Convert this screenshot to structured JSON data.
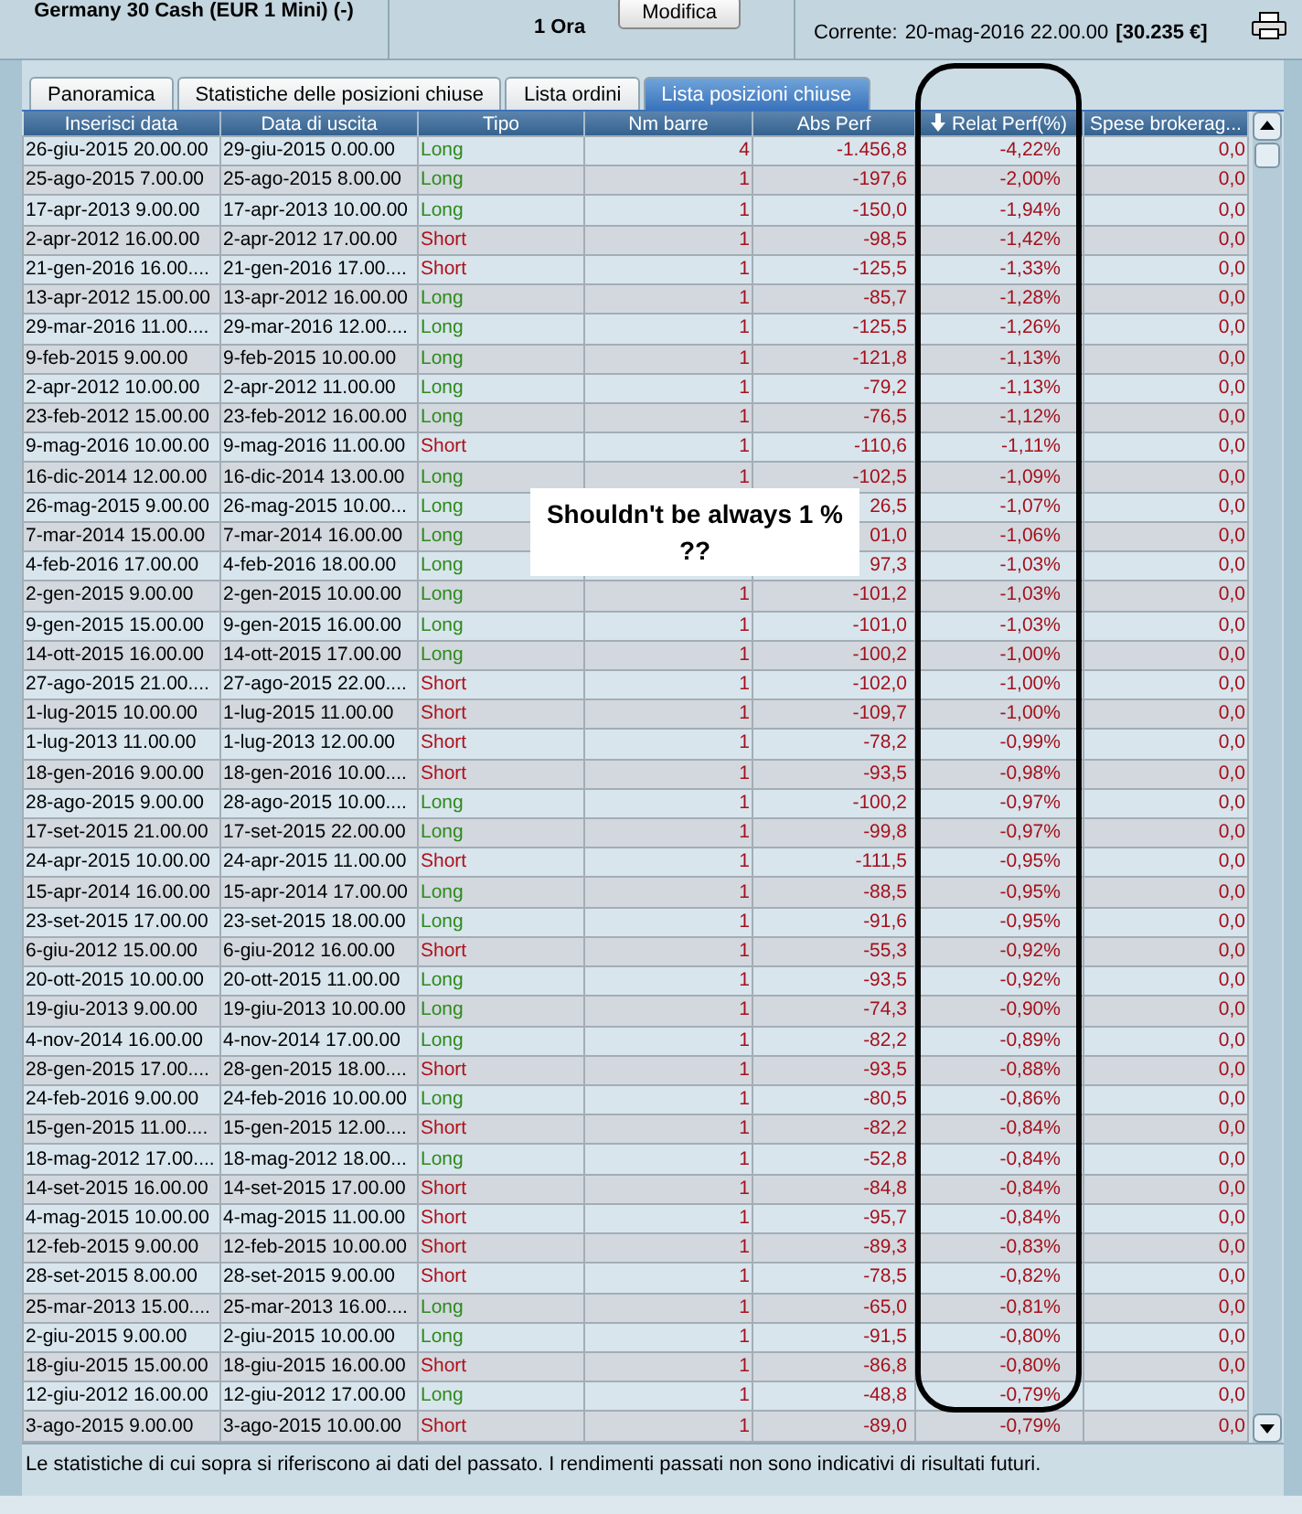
{
  "header": {
    "instrument": "Germany 30 Cash (EUR 1 Mini) (-)",
    "unit": "1 Ora",
    "modify_button": "Modifica",
    "current_label": "Corrente:",
    "current_date": "20-mag-2016 22.00.00",
    "current_value": "[30.235 €]"
  },
  "tabs": [
    {
      "label": "Panoramica",
      "selected": false
    },
    {
      "label": "Statistiche delle posizioni chiuse",
      "selected": false
    },
    {
      "label": "Lista ordini",
      "selected": false
    },
    {
      "label": "Lista posizioni chiuse",
      "selected": true
    }
  ],
  "table": {
    "columns": [
      {
        "label": "Inserisci data",
        "sorted": false
      },
      {
        "label": "Data di uscita",
        "sorted": false
      },
      {
        "label": "Tipo",
        "sorted": false
      },
      {
        "label": "Nm barre",
        "sorted": false
      },
      {
        "label": "Abs Perf",
        "sorted": false
      },
      {
        "label": "Relat Perf(%)",
        "sorted": true
      },
      {
        "label": "Spese brokerag...",
        "sorted": false
      }
    ],
    "rows": [
      {
        "entry": "26-giu-2015 20.00.00",
        "exit": "29-giu-2015 0.00.00",
        "type": "Long",
        "kind": "long",
        "bars": "4",
        "abs": "-1.456,8",
        "rel": "-4,22%",
        "fees": "0,0"
      },
      {
        "entry": "25-ago-2015 7.00.00",
        "exit": "25-ago-2015 8.00.00",
        "type": "Long",
        "kind": "long",
        "bars": "1",
        "abs": "-197,6",
        "rel": "-2,00%",
        "fees": "0,0"
      },
      {
        "entry": "17-apr-2013 9.00.00",
        "exit": "17-apr-2013 10.00.00",
        "type": "Long",
        "kind": "long",
        "bars": "1",
        "abs": "-150,0",
        "rel": "-1,94%",
        "fees": "0,0"
      },
      {
        "entry": "2-apr-2012 16.00.00",
        "exit": "2-apr-2012 17.00.00",
        "type": "Short",
        "kind": "short",
        "bars": "1",
        "abs": "-98,5",
        "rel": "-1,42%",
        "fees": "0,0"
      },
      {
        "entry": "21-gen-2016 16.00....",
        "exit": "21-gen-2016 17.00....",
        "type": "Short",
        "kind": "short",
        "bars": "1",
        "abs": "-125,5",
        "rel": "-1,33%",
        "fees": "0,0"
      },
      {
        "entry": "13-apr-2012 15.00.00",
        "exit": "13-apr-2012 16.00.00",
        "type": "Long",
        "kind": "long",
        "bars": "1",
        "abs": "-85,7",
        "rel": "-1,28%",
        "fees": "0,0"
      },
      {
        "entry": "29-mar-2016 11.00....",
        "exit": "29-mar-2016 12.00....",
        "type": "Long",
        "kind": "long",
        "bars": "1",
        "abs": "-125,5",
        "rel": "-1,26%",
        "fees": "0,0"
      },
      {
        "entry": "9-feb-2015 9.00.00",
        "exit": "9-feb-2015 10.00.00",
        "type": "Long",
        "kind": "long",
        "bars": "1",
        "abs": "-121,8",
        "rel": "-1,13%",
        "fees": "0,0"
      },
      {
        "entry": "2-apr-2012 10.00.00",
        "exit": "2-apr-2012 11.00.00",
        "type": "Long",
        "kind": "long",
        "bars": "1",
        "abs": "-79,2",
        "rel": "-1,13%",
        "fees": "0,0"
      },
      {
        "entry": "23-feb-2012 15.00.00",
        "exit": "23-feb-2012 16.00.00",
        "type": "Long",
        "kind": "long",
        "bars": "1",
        "abs": "-76,5",
        "rel": "-1,12%",
        "fees": "0,0"
      },
      {
        "entry": "9-mag-2016 10.00.00",
        "exit": "9-mag-2016 11.00.00",
        "type": "Short",
        "kind": "short",
        "bars": "1",
        "abs": "-110,6",
        "rel": "-1,11%",
        "fees": "0,0"
      },
      {
        "entry": "16-dic-2014 12.00.00",
        "exit": "16-dic-2014 13.00.00",
        "type": "Long",
        "kind": "long",
        "bars": "1",
        "abs": "-102,5",
        "rel": "-1,09%",
        "fees": "0,0"
      },
      {
        "entry": "26-mag-2015 9.00.00",
        "exit": "26-mag-2015 10.00...",
        "type": "Long",
        "kind": "long",
        "abs": "26,5",
        "rel": "-1,07%",
        "fees": "0,0"
      },
      {
        "entry": "7-mar-2014 15.00.00",
        "exit": "7-mar-2014 16.00.00",
        "type": "Long",
        "kind": "long",
        "abs": "01,0",
        "rel": "-1,06%",
        "fees": "0,0"
      },
      {
        "entry": "4-feb-2016 17.00.00",
        "exit": "4-feb-2016 18.00.00",
        "type": "Long",
        "kind": "long",
        "abs": "97,3",
        "rel": "-1,03%",
        "fees": "0,0"
      },
      {
        "entry": "2-gen-2015 9.00.00",
        "exit": "2-gen-2015 10.00.00",
        "type": "Long",
        "kind": "long",
        "bars": "1",
        "abs": "-101,2",
        "rel": "-1,03%",
        "fees": "0,0"
      },
      {
        "entry": "9-gen-2015 15.00.00",
        "exit": "9-gen-2015 16.00.00",
        "type": "Long",
        "kind": "long",
        "bars": "1",
        "abs": "-101,0",
        "rel": "-1,03%",
        "fees": "0,0"
      },
      {
        "entry": "14-ott-2015 16.00.00",
        "exit": "14-ott-2015 17.00.00",
        "type": "Long",
        "kind": "long",
        "bars": "1",
        "abs": "-100,2",
        "rel": "-1,00%",
        "fees": "0,0"
      },
      {
        "entry": "27-ago-2015 21.00....",
        "exit": "27-ago-2015 22.00....",
        "type": "Short",
        "kind": "short",
        "bars": "1",
        "abs": "-102,0",
        "rel": "-1,00%",
        "fees": "0,0"
      },
      {
        "entry": "1-lug-2015 10.00.00",
        "exit": "1-lug-2015 11.00.00",
        "type": "Short",
        "kind": "short",
        "bars": "1",
        "abs": "-109,7",
        "rel": "-1,00%",
        "fees": "0,0"
      },
      {
        "entry": "1-lug-2013 11.00.00",
        "exit": "1-lug-2013 12.00.00",
        "type": "Short",
        "kind": "short",
        "bars": "1",
        "abs": "-78,2",
        "rel": "-0,99%",
        "fees": "0,0"
      },
      {
        "entry": "18-gen-2016 9.00.00",
        "exit": "18-gen-2016 10.00....",
        "type": "Short",
        "kind": "short",
        "bars": "1",
        "abs": "-93,5",
        "rel": "-0,98%",
        "fees": "0,0"
      },
      {
        "entry": "28-ago-2015 9.00.00",
        "exit": "28-ago-2015 10.00....",
        "type": "Long",
        "kind": "long",
        "bars": "1",
        "abs": "-100,2",
        "rel": "-0,97%",
        "fees": "0,0"
      },
      {
        "entry": "17-set-2015 21.00.00",
        "exit": "17-set-2015 22.00.00",
        "type": "Long",
        "kind": "long",
        "bars": "1",
        "abs": "-99,8",
        "rel": "-0,97%",
        "fees": "0,0"
      },
      {
        "entry": "24-apr-2015 10.00.00",
        "exit": "24-apr-2015 11.00.00",
        "type": "Short",
        "kind": "short",
        "bars": "1",
        "abs": "-111,5",
        "rel": "-0,95%",
        "fees": "0,0"
      },
      {
        "entry": "15-apr-2014 16.00.00",
        "exit": "15-apr-2014 17.00.00",
        "type": "Long",
        "kind": "long",
        "bars": "1",
        "abs": "-88,5",
        "rel": "-0,95%",
        "fees": "0,0"
      },
      {
        "entry": "23-set-2015 17.00.00",
        "exit": "23-set-2015 18.00.00",
        "type": "Long",
        "kind": "long",
        "bars": "1",
        "abs": "-91,6",
        "rel": "-0,95%",
        "fees": "0,0"
      },
      {
        "entry": "6-giu-2012 15.00.00",
        "exit": "6-giu-2012 16.00.00",
        "type": "Short",
        "kind": "short",
        "bars": "1",
        "abs": "-55,3",
        "rel": "-0,92%",
        "fees": "0,0"
      },
      {
        "entry": "20-ott-2015 10.00.00",
        "exit": "20-ott-2015 11.00.00",
        "type": "Long",
        "kind": "long",
        "bars": "1",
        "abs": "-93,5",
        "rel": "-0,92%",
        "fees": "0,0"
      },
      {
        "entry": "19-giu-2013 9.00.00",
        "exit": "19-giu-2013 10.00.00",
        "type": "Long",
        "kind": "long",
        "bars": "1",
        "abs": "-74,3",
        "rel": "-0,90%",
        "fees": "0,0"
      },
      {
        "entry": "4-nov-2014 16.00.00",
        "exit": "4-nov-2014 17.00.00",
        "type": "Long",
        "kind": "long",
        "bars": "1",
        "abs": "-82,2",
        "rel": "-0,89%",
        "fees": "0,0"
      },
      {
        "entry": "28-gen-2015 17.00....",
        "exit": "28-gen-2015 18.00....",
        "type": "Short",
        "kind": "short",
        "bars": "1",
        "abs": "-93,5",
        "rel": "-0,88%",
        "fees": "0,0"
      },
      {
        "entry": "24-feb-2016 9.00.00",
        "exit": "24-feb-2016 10.00.00",
        "type": "Long",
        "kind": "long",
        "bars": "1",
        "abs": "-80,5",
        "rel": "-0,86%",
        "fees": "0,0"
      },
      {
        "entry": "15-gen-2015 11.00....",
        "exit": "15-gen-2015 12.00....",
        "type": "Short",
        "kind": "short",
        "bars": "1",
        "abs": "-82,2",
        "rel": "-0,84%",
        "fees": "0,0"
      },
      {
        "entry": "18-mag-2012 17.00....",
        "exit": "18-mag-2012 18.00...",
        "type": "Long",
        "kind": "long",
        "bars": "1",
        "abs": "-52,8",
        "rel": "-0,84%",
        "fees": "0,0"
      },
      {
        "entry": "14-set-2015 16.00.00",
        "exit": "14-set-2015 17.00.00",
        "type": "Short",
        "kind": "short",
        "bars": "1",
        "abs": "-84,8",
        "rel": "-0,84%",
        "fees": "0,0"
      },
      {
        "entry": "4-mag-2015 10.00.00",
        "exit": "4-mag-2015 11.00.00",
        "type": "Short",
        "kind": "short",
        "bars": "1",
        "abs": "-95,7",
        "rel": "-0,84%",
        "fees": "0,0"
      },
      {
        "entry": "12-feb-2015 9.00.00",
        "exit": "12-feb-2015 10.00.00",
        "type": "Short",
        "kind": "short",
        "bars": "1",
        "abs": "-89,3",
        "rel": "-0,83%",
        "fees": "0,0"
      },
      {
        "entry": "28-set-2015 8.00.00",
        "exit": "28-set-2015 9.00.00",
        "type": "Short",
        "kind": "short",
        "bars": "1",
        "abs": "-78,5",
        "rel": "-0,82%",
        "fees": "0,0"
      },
      {
        "entry": "25-mar-2013 15.00....",
        "exit": "25-mar-2013 16.00....",
        "type": "Long",
        "kind": "long",
        "bars": "1",
        "abs": "-65,0",
        "rel": "-0,81%",
        "fees": "0,0"
      },
      {
        "entry": "2-giu-2015 9.00.00",
        "exit": "2-giu-2015 10.00.00",
        "type": "Long",
        "kind": "long",
        "bars": "1",
        "abs": "-91,5",
        "rel": "-0,80%",
        "fees": "0,0"
      },
      {
        "entry": "18-giu-2015 15.00.00",
        "exit": "18-giu-2015 16.00.00",
        "type": "Short",
        "kind": "short",
        "bars": "1",
        "abs": "-86,8",
        "rel": "-0,80%",
        "fees": "0,0"
      },
      {
        "entry": "12-giu-2012 16.00.00",
        "exit": "12-giu-2012 17.00.00",
        "type": "Long",
        "kind": "long",
        "bars": "1",
        "abs": "-48,8",
        "rel": "-0,79%",
        "fees": "0,0"
      },
      {
        "entry": "3-ago-2015 9.00.00",
        "exit": "3-ago-2015 10.00.00",
        "type": "Short",
        "kind": "short",
        "bars": "1",
        "abs": "-89,0",
        "rel": "-0,79%",
        "fees": "0,0"
      }
    ]
  },
  "annotation": {
    "lines": [
      "Shouldn't be always 1 %",
      "??"
    ]
  },
  "status_bar": "Le statistiche di cui sopra si riferiscono ai dati del passato. I rendimenti passati non sono indicativi di risultati futuri."
}
